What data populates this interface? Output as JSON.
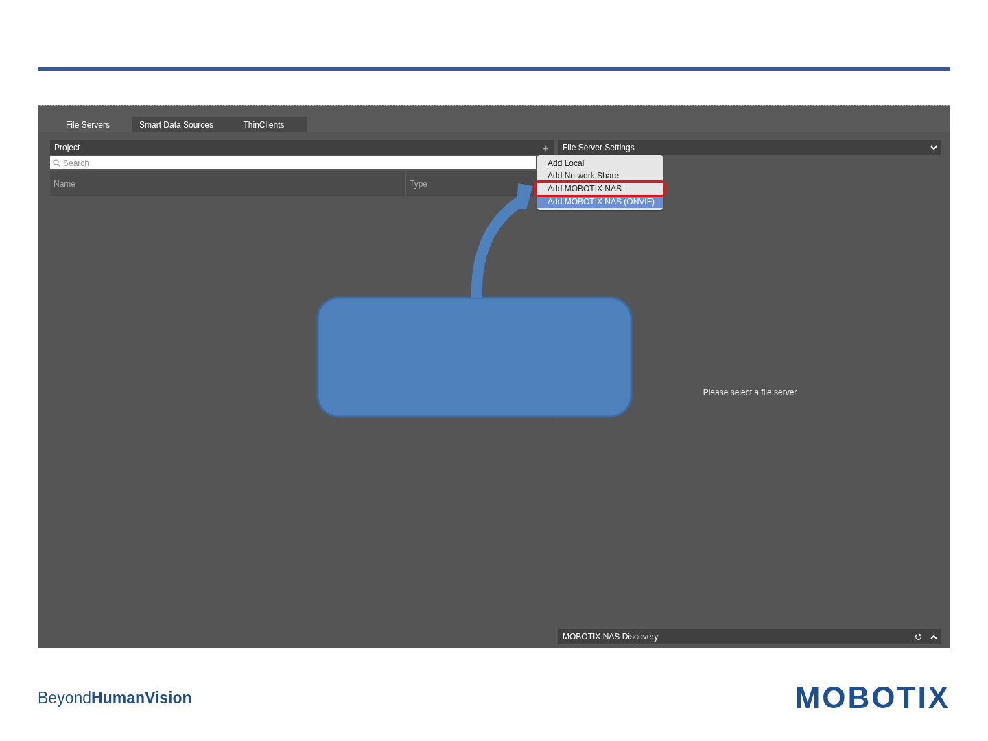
{
  "tabs": [
    {
      "label": "File Servers",
      "selected": true
    },
    {
      "label": "Smart Data Sources",
      "selected": false
    },
    {
      "label": "ThinClients",
      "selected": false
    }
  ],
  "project_panel": {
    "title": "Project",
    "add_button": "+",
    "search": {
      "placeholder": "Search"
    },
    "columns": [
      "Name",
      "Type"
    ]
  },
  "add_menu": {
    "items": [
      {
        "label": "Add Local",
        "selected": false,
        "outlined": false
      },
      {
        "label": "Add Network Share",
        "selected": false,
        "outlined": false
      },
      {
        "label": "Add MOBOTIX NAS",
        "selected": false,
        "outlined": true
      },
      {
        "label": "Add MOBOTIX NAS (ONVIF)",
        "selected": true,
        "outlined": false
      }
    ]
  },
  "settings_panel": {
    "title": "File Server Settings",
    "message": "Please select a file server",
    "discovery": {
      "title": "MOBOTIX NAS Discovery"
    }
  },
  "footer": {
    "tagline": "Beyond**HumanVision**",
    "logo": "MOBOTIX"
  }
}
